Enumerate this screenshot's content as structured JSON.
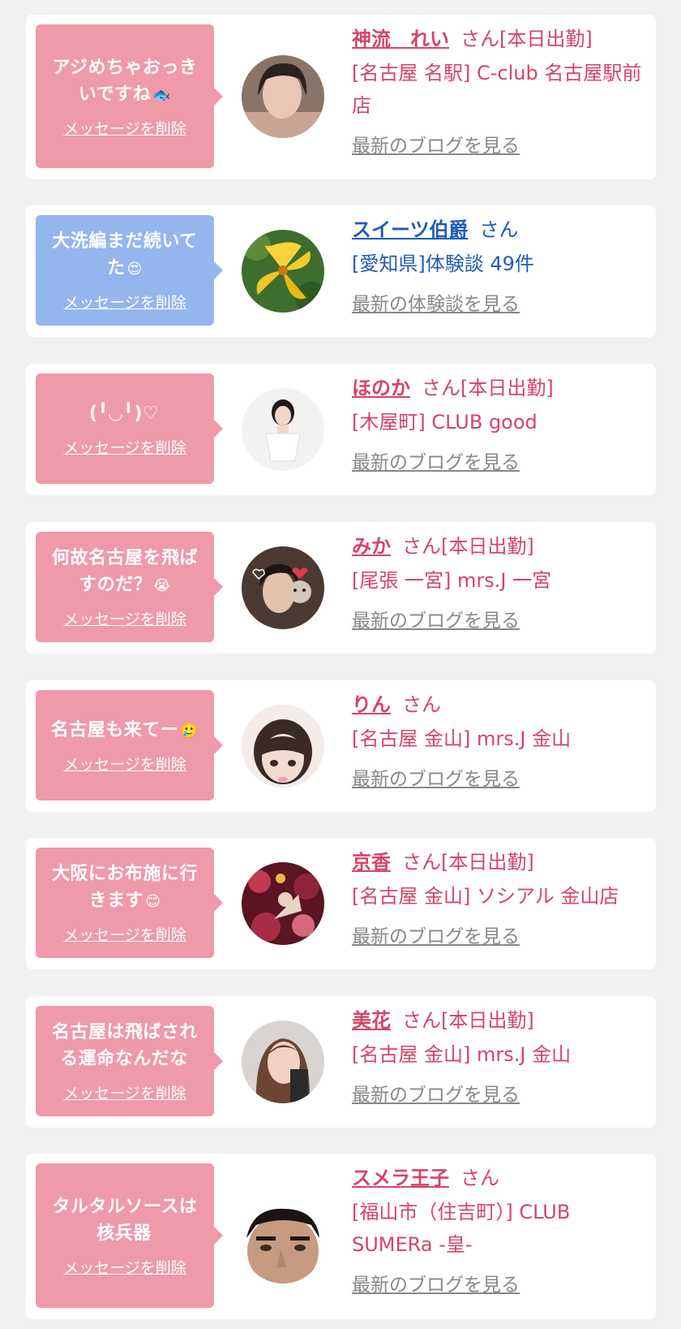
{
  "colors": {
    "background": "#f1f1f2",
    "card": "#ffffff",
    "pink_bubble": "#ee9aa9",
    "blue_bubble": "#95b5ee",
    "pink_text": "#d64468",
    "blue_text": "#1f5cb8",
    "link_gray": "#888888"
  },
  "delete_label": "メッセージを削除",
  "entries": [
    {
      "message": "アジめちゃおっきいですね",
      "emoji": "🐟",
      "name": "神流　れい",
      "suffix": "さん[本日出勤]",
      "shop": "[名古屋 名駅] C-club 名古屋駅前店",
      "link": "最新のブログを見る",
      "theme": "pink"
    },
    {
      "message": "大洗編まだ続いてた",
      "emoji": "😍",
      "name": "スイーツ伯爵",
      "suffix": "さん",
      "shop": "[愛知県]体験談 49件",
      "link": "最新の体験談を見る",
      "theme": "blue"
    },
    {
      "message": "(╹◡╹)♡",
      "emoji": "",
      "name": "ほのか",
      "suffix": "さん[本日出勤]",
      "shop": "[木屋町] CLUB good",
      "link": "最新のブログを見る",
      "theme": "pink"
    },
    {
      "message": "何故名古屋を飛ばすのだ？",
      "emoji": "😭",
      "name": "みか",
      "suffix": "さん[本日出勤]",
      "shop": "[尾張 一宮] mrs.J 一宮",
      "link": "最新のブログを見る",
      "theme": "pink"
    },
    {
      "message": "名古屋も来てー",
      "emoji": "🥲",
      "name": "りん",
      "suffix": "さん",
      "shop": "[名古屋 金山] mrs.J 金山",
      "link": "最新のブログを見る",
      "theme": "pink"
    },
    {
      "message": "大阪にお布施に行きます",
      "emoji": "😊",
      "name": "京香",
      "suffix": "さん[本日出勤]",
      "shop": "[名古屋 金山] ソシアル 金山店",
      "link": "最新のブログを見る",
      "theme": "pink"
    },
    {
      "message": "名古屋は飛ばされる運命なんだな",
      "emoji": "",
      "name": "美花",
      "suffix": "さん[本日出勤]",
      "shop": "[名古屋 金山] mrs.J 金山",
      "link": "最新のブログを見る",
      "theme": "pink"
    },
    {
      "message": "タルタルソースは核兵器",
      "emoji": "",
      "name": "スメラ王子",
      "suffix": "さん",
      "shop": "[福山市（住吉町）] CLUB SUMERa -皇-",
      "link": "最新のブログを見る",
      "theme": "pink"
    }
  ]
}
